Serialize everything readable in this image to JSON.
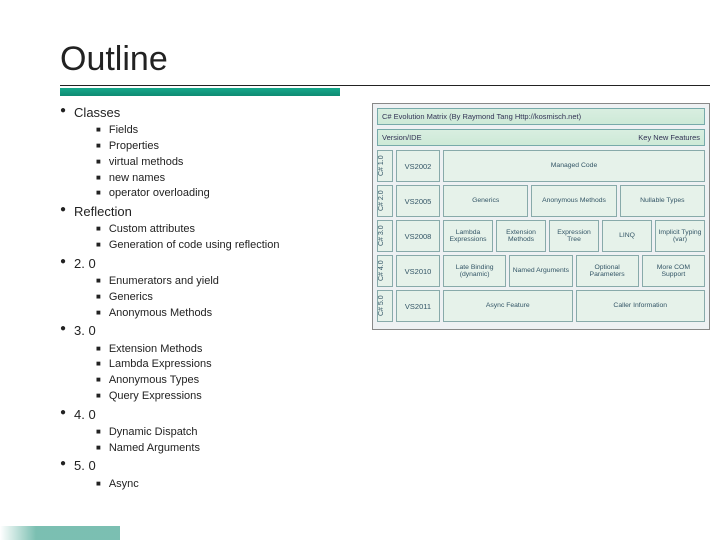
{
  "title": "Outline",
  "outline": [
    {
      "label": "Classes",
      "items": [
        "Fields",
        "Properties",
        "virtual methods",
        "new names",
        "operator overloading"
      ]
    },
    {
      "label": "Reflection",
      "items": [
        "Custom attributes",
        "Generation of code using reflection"
      ]
    },
    {
      "label": "2. 0",
      "items": [
        "Enumerators and yield",
        "Generics",
        "Anonymous Methods"
      ]
    },
    {
      "label": "3. 0",
      "items": [
        "Extension Methods",
        "Lambda Expressions",
        "Anonymous Types",
        "Query Expressions"
      ]
    },
    {
      "label": "4. 0",
      "items": [
        "Dynamic Dispatch",
        "Named Arguments"
      ]
    },
    {
      "label": "5. 0",
      "items": [
        "Async"
      ]
    }
  ],
  "chart_data": {
    "type": "table",
    "title": "C# Evolution Matrix (By Raymond Tang Http://kosmisch.net)",
    "col_left_label": "Version/IDE",
    "col_right_label": "Key New Features",
    "rows": [
      {
        "ver": "C# 1.0",
        "vs": "VS2002",
        "features": [
          "Managed Code"
        ]
      },
      {
        "ver": "C# 2.0",
        "vs": "VS2005",
        "features": [
          "Generics",
          "Anonymous Methods",
          "Nullable Types"
        ]
      },
      {
        "ver": "C# 3.0",
        "vs": "VS2008",
        "features": [
          "Lambda Expressions",
          "Extension Methods",
          "Expression Tree",
          "LINQ",
          "Implicit Typing (var)"
        ]
      },
      {
        "ver": "C# 4.0",
        "vs": "VS2010",
        "features": [
          "Late Binding (dynamic)",
          "Named Arguments",
          "Optional Parameters",
          "More COM Support"
        ]
      },
      {
        "ver": "C# 5.0",
        "vs": "VS2011",
        "features": [
          "Async Feature",
          "Caller Information"
        ]
      }
    ]
  }
}
